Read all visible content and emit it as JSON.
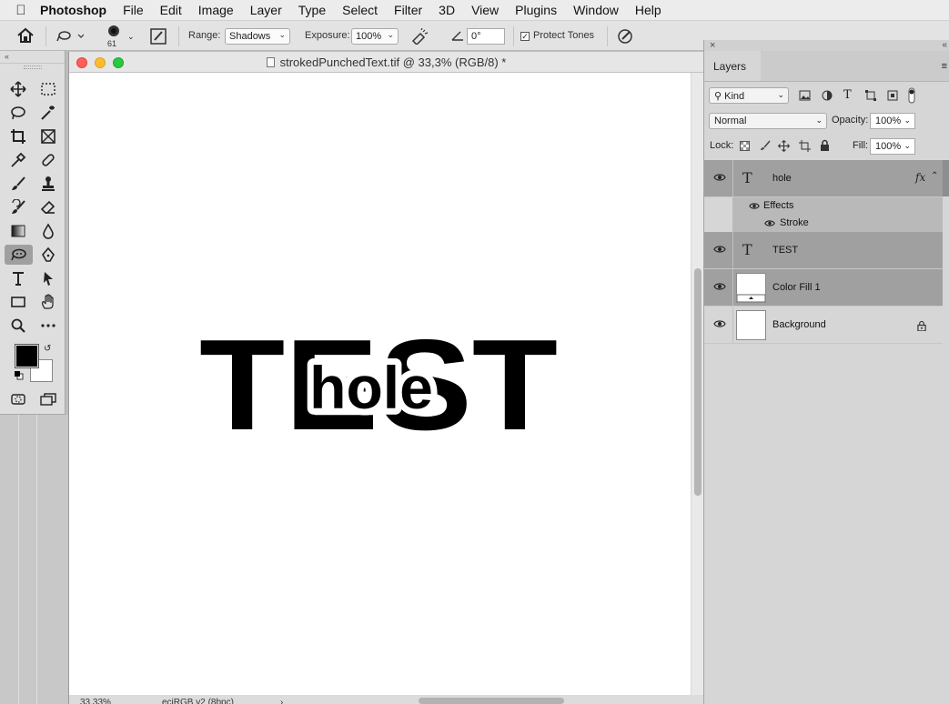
{
  "menubar": {
    "items": [
      "Photoshop",
      "File",
      "Edit",
      "Image",
      "Layer",
      "Type",
      "Select",
      "Filter",
      "3D",
      "View",
      "Plugins",
      "Window",
      "Help"
    ]
  },
  "options": {
    "brush_size": "61",
    "range_label": "Range:",
    "range_value": "Shadows",
    "exposure_label": "Exposure:",
    "exposure_value": "100%",
    "angle_value": "0°",
    "protect_tones_label": "Protect Tones",
    "protect_tones_checked": true
  },
  "document": {
    "title": "strokedPunchedText.tif @ 33,3% (RGB/8) *",
    "canvas_text_main": "TEST",
    "canvas_text_punch": "hole",
    "zoom": "33,33%",
    "color_profile": "eciRGB v2 (8bpc)"
  },
  "layers_panel": {
    "tab": "Layers",
    "filter_kind": "Kind",
    "blend_mode": "Normal",
    "opacity_label": "Opacity:",
    "opacity_value": "100%",
    "lock_label": "Lock:",
    "fill_label": "Fill:",
    "fill_value": "100%",
    "layers": [
      {
        "name": "hole",
        "type": "text",
        "selected": true,
        "fx": "fx"
      },
      {
        "name": "TEST",
        "type": "text",
        "selected": true
      },
      {
        "name": "Color Fill 1",
        "type": "fill",
        "selected": true
      },
      {
        "name": "Background",
        "type": "pixel",
        "selected": false
      }
    ],
    "effects_label": "Effects",
    "stroke_label": "Stroke"
  },
  "colors": {
    "foreground": "#000000",
    "background": "#ffffff",
    "selected_layer": "#a0a0a0"
  }
}
